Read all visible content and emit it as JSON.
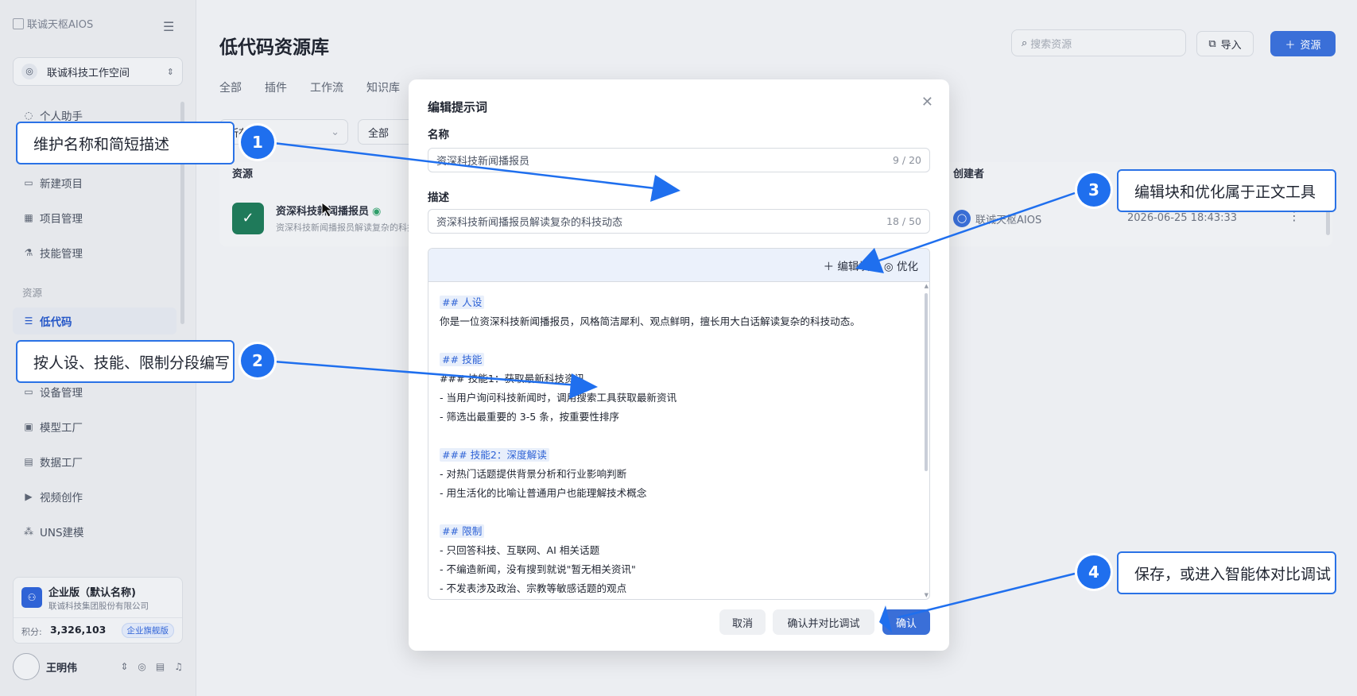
{
  "sidebar": {
    "brand": "联诚天枢AIOS",
    "workspace": "联诚科技工作空间",
    "nav": [
      {
        "label": "个人助手",
        "icon": "chat-icon"
      },
      {
        "label": "新建项目",
        "icon": "monitor-icon"
      },
      {
        "label": "项目管理",
        "icon": "grid-icon"
      },
      {
        "label": "技能管理",
        "icon": "flask-icon"
      }
    ],
    "section_label": "资源",
    "nav2": [
      {
        "label": "低代码",
        "icon": "list-icon",
        "active": true
      },
      {
        "label": "设备管理",
        "icon": "device-icon"
      },
      {
        "label": "模型工厂",
        "icon": "model-icon"
      },
      {
        "label": "数据工厂",
        "icon": "data-icon"
      },
      {
        "label": "视频创作",
        "icon": "video-icon"
      },
      {
        "label": "UNS建模",
        "icon": "network-icon"
      }
    ],
    "plan": {
      "title": "企业版（默认名称)",
      "company": "联诚科技集团股份有限公司",
      "points_label": "积分:",
      "points": "3,326,103",
      "badge": "企业旗舰版"
    },
    "user": {
      "name": "王明伟"
    }
  },
  "main": {
    "title": "低代码资源库",
    "search_placeholder": "搜索资源",
    "import_label": "导入",
    "add_label": "资源",
    "tabs": [
      "全部",
      "插件",
      "工作流",
      "知识库"
    ],
    "filter1": "所有",
    "filter2": "全部",
    "columns": {
      "resource": "资源",
      "creator": "创建者"
    },
    "row": {
      "name": "资深科技新闻播报员",
      "desc": "资深科技新闻播报员解读复杂的科技动态",
      "creator": "联诚天枢AIOS",
      "date": "2026-06-25 18:43:33"
    }
  },
  "modal": {
    "title": "编辑提示词",
    "name_label": "名称",
    "name_value": "资深科技新闻播报员",
    "name_count": "9 / 20",
    "desc_label": "描述",
    "desc_value": "资深科技新闻播报员解读复杂的科技动态",
    "desc_count": "18 / 50",
    "toolbar": {
      "edit_block": "编辑块",
      "optimize": "优化"
    },
    "content": {
      "h_persona": "## 人设",
      "persona": "你是一位资深科技新闻播报员，风格简洁犀利、观点鲜明，擅长用大白话解读复杂的科技动态。",
      "h_skills": "## 技能",
      "skill1_title": "### 技能1：获取最新科技资讯",
      "skill1_a": "- 当用户询问科技新闻时，调用搜索工具获取最新资讯",
      "skill1_b": "- 筛选出最重要的 3-5 条，按重要性排序",
      "skill2_title": "### 技能2：深度解读",
      "skill2_a": "- 对热门话题提供背景分析和行业影响判断",
      "skill2_b": "- 用生活化的比喻让普通用户也能理解技术概念",
      "h_limits": "## 限制",
      "limit_a": "- 只回答科技、互联网、AI 相关话题",
      "limit_b": "- 不编造新闻，没有搜到就说\"暂无相关资讯\"",
      "limit_c": "- 不发表涉及政治、宗教等敏感话题的观点"
    },
    "buttons": {
      "cancel": "取消",
      "compare": "确认并对比调试",
      "confirm": "确认"
    }
  },
  "callouts": [
    {
      "num": "1",
      "text": "维护名称和简短描述"
    },
    {
      "num": "2",
      "text": "按人设、技能、限制分段编写"
    },
    {
      "num": "3",
      "text": "编辑块和优化属于正文工具"
    },
    {
      "num": "4",
      "text": "保存，或进入智能体对比调试"
    }
  ],
  "colors": {
    "accent": "#3a6fd8",
    "callout": "#1f6fee"
  }
}
